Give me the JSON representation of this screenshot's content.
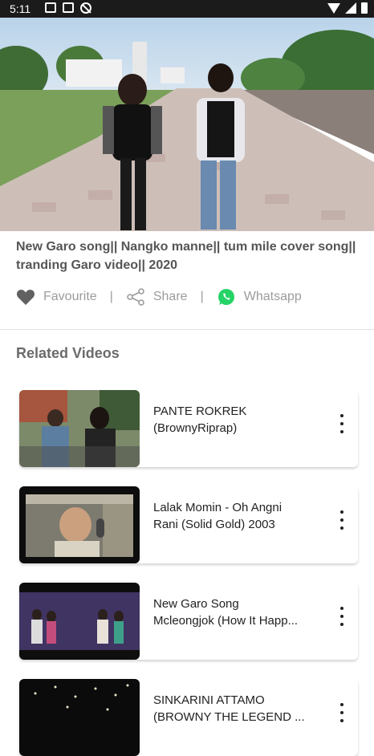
{
  "status": {
    "time": "5:11"
  },
  "video": {
    "title": "New Garo song|| Nangko manne|| tum mile cover song|| tranding Garo video|| 2020"
  },
  "actions": {
    "favourite": "Favourite",
    "share": "Share",
    "whatsapp": "Whatsapp",
    "separator": "|"
  },
  "related": {
    "heading": "Related Videos",
    "items": [
      {
        "title_line1": "PANTE ROKREK",
        "title_line2": "(BrownyRiprap)"
      },
      {
        "title_line1": "Lalak Momin - Oh Angni",
        "title_line2": "Rani (Solid Gold) 2003"
      },
      {
        "title_line1": "New Garo Song",
        "title_line2": "Mcleongjok (How It Happ..."
      },
      {
        "title_line1": "SINKARINI ATTAMO",
        "title_line2": "(BROWNY THE LEGEND ..."
      }
    ]
  },
  "colors": {
    "whatsapp": "#25d366",
    "status_bar": "#1b1b1b",
    "muted_text": "#9c9c9c"
  }
}
